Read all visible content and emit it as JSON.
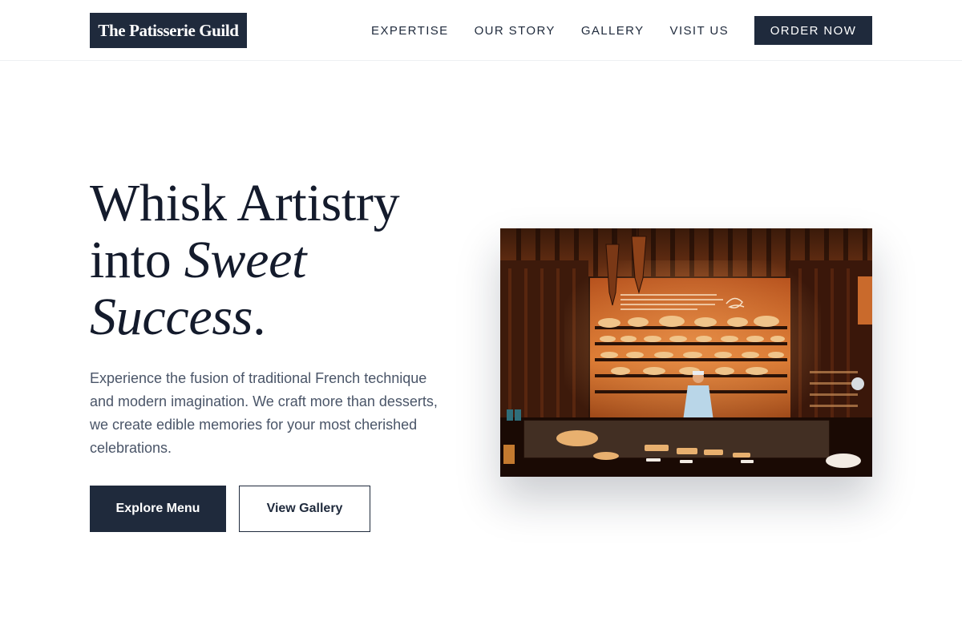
{
  "header": {
    "logo": "The Patisserie Guild",
    "nav": [
      "EXPERTISE",
      "OUR STORY",
      "GALLERY",
      "VISIT US"
    ],
    "cta": "ORDER NOW"
  },
  "hero": {
    "title_line1": "Whisk Artistry",
    "title_line2_plain": "into ",
    "title_line2_italic": "Sweet",
    "title_line3_italic": "Success",
    "title_line3_end": ".",
    "description": "Experience the fusion of traditional French technique and modern imagination. We craft more than desserts, we create edible memories for your most cherished celebrations.",
    "primary_button": "Explore Menu",
    "secondary_button": "View Gallery",
    "image_icon": "bakery-interior-photo"
  },
  "colors": {
    "navy": "#1f2a3c",
    "heading": "#141b2c",
    "body_text": "#4a5568",
    "background": "#ffffff"
  }
}
